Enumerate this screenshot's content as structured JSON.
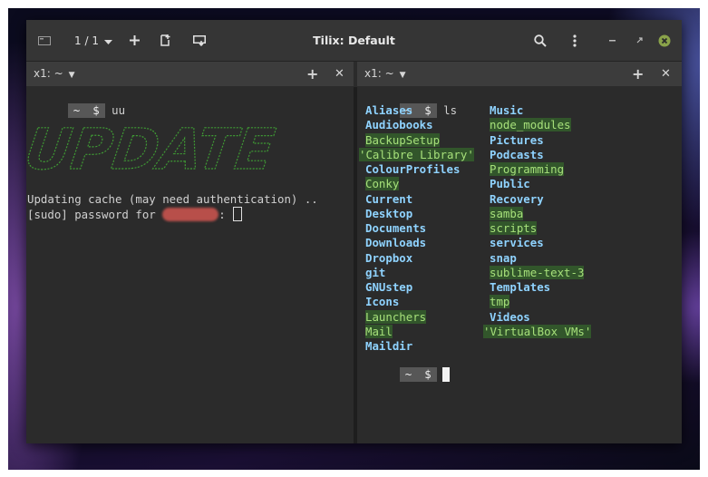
{
  "window": {
    "title": "Tilix: Default",
    "session_count": "1 / 1"
  },
  "left_pane": {
    "header_title": "x1: ~",
    "prompt_dir": "~",
    "prompt_symbol": "$",
    "command": "uu",
    "banner_text": "UPDATE",
    "output_line_1": "Updating cache (may need authentication) ..",
    "output_line_2_prefix": "[sudo] password for ",
    "output_line_2_suffix": ":"
  },
  "right_pane": {
    "header_title": "x1: ~",
    "prompt_dir": "~",
    "prompt_symbol": "$",
    "command": "ls",
    "column_1": [
      {
        "name": "Aliases",
        "style": "bold"
      },
      {
        "name": "Audiobooks",
        "style": "bold"
      },
      {
        "name": "BackupSetup",
        "style": "hl"
      },
      {
        "name": "'Calibre Library'",
        "style": "hl"
      },
      {
        "name": "ColourProfiles",
        "style": "bold"
      },
      {
        "name": "Conky",
        "style": "hl"
      },
      {
        "name": "Current",
        "style": "bold"
      },
      {
        "name": "Desktop",
        "style": "bold"
      },
      {
        "name": "Documents",
        "style": "bold"
      },
      {
        "name": "Downloads",
        "style": "bold"
      },
      {
        "name": "Dropbox",
        "style": "bold"
      },
      {
        "name": "git",
        "style": "bold"
      },
      {
        "name": "GNUstep",
        "style": "bold"
      },
      {
        "name": "Icons",
        "style": "bold"
      },
      {
        "name": "Launchers",
        "style": "hl"
      },
      {
        "name": "Mail",
        "style": "hl"
      },
      {
        "name": "Maildir",
        "style": "bold"
      }
    ],
    "column_2": [
      {
        "name": "Music",
        "style": "bold"
      },
      {
        "name": "node_modules",
        "style": "hl"
      },
      {
        "name": "Pictures",
        "style": "bold"
      },
      {
        "name": "Podcasts",
        "style": "bold"
      },
      {
        "name": "Programming",
        "style": "hl"
      },
      {
        "name": "Public",
        "style": "bold"
      },
      {
        "name": "Recovery",
        "style": "bold"
      },
      {
        "name": "samba",
        "style": "hl"
      },
      {
        "name": "scripts",
        "style": "hl"
      },
      {
        "name": "services",
        "style": "bold"
      },
      {
        "name": "snap",
        "style": "bold"
      },
      {
        "name": "sublime-text-3",
        "style": "hl"
      },
      {
        "name": "Templates",
        "style": "bold"
      },
      {
        "name": "tmp",
        "style": "hl"
      },
      {
        "name": "Videos",
        "style": "bold"
      },
      {
        "name": "'VirtualBox VMs'",
        "style": "hl"
      }
    ]
  },
  "colors": {
    "dir_bold": "#8fd3ff",
    "dir_highlight_bg": "#32562b",
    "dir_highlight_fg": "#a6e07a",
    "banner_green": "#3f9b34"
  },
  "icons": {
    "terminal": "terminal-icon",
    "session_dropdown": "chevron-down-icon",
    "add_session": "plus-icon",
    "split": "new-window-icon",
    "sync": "sync-input-icon",
    "search": "search-icon",
    "menu": "kebab-menu-icon",
    "minimize": "minimize-icon",
    "maximize": "maximize-icon",
    "close": "close-icon"
  }
}
